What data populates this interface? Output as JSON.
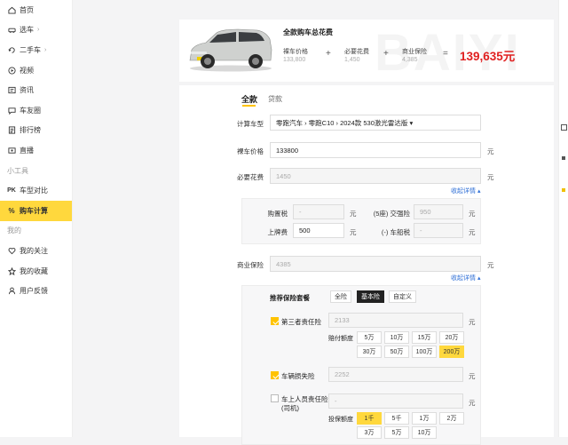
{
  "sidebar": {
    "items": [
      {
        "label": "首页",
        "icon": "home-icon"
      },
      {
        "label": "选车",
        "icon": "car-icon",
        "chev": "›"
      },
      {
        "label": "二手车",
        "icon": "used-car-icon",
        "chev": "›"
      },
      {
        "label": "视频",
        "icon": "video-icon"
      },
      {
        "label": "资讯",
        "icon": "news-icon"
      },
      {
        "label": "车友圈",
        "icon": "community-icon"
      },
      {
        "label": "排行榜",
        "icon": "ranking-icon"
      },
      {
        "label": "直播",
        "icon": "live-icon"
      }
    ],
    "section_tools": "小工具",
    "tools": [
      {
        "label": "车型对比",
        "icon": "compare-icon",
        "prefix": "PK"
      },
      {
        "label": "购车计算",
        "icon": "calculator-icon",
        "prefix": "%"
      }
    ],
    "section_mine": "我的",
    "mine": [
      {
        "label": "我的关注",
        "icon": "heart-icon"
      },
      {
        "label": "我的收藏",
        "icon": "star-icon"
      },
      {
        "label": "用户反馈",
        "icon": "feedback-icon"
      }
    ]
  },
  "summary": {
    "title": "全款购车总花费",
    "bg_word": "BAIYI",
    "price_label": "裸车价格",
    "price_value": "133,800",
    "required_label": "必要花费",
    "required_value": "1,450",
    "insurance_label": "商业保险",
    "insurance_value": "4,385",
    "plus": "+",
    "equals": "=",
    "total": "139,635元",
    "colors": {
      "accent": "#e02020",
      "brand": "#ffd83d"
    }
  },
  "tabs": {
    "full": "全款",
    "loan": "贷款"
  },
  "form": {
    "model_label": "计算车型",
    "model_value": "零跑汽车 › 零跑C10 › 2024款 530激光雷达版 ▾",
    "price_label": "裸车价格",
    "price_value": "133800",
    "unit": "元",
    "required_label": "必要花费",
    "required_value": "1450",
    "collapse_link": "收起详情 ▴",
    "purchase_tax_label": "购置税",
    "purchase_tax_value": "-",
    "compulsory_label": "(5座) 交强险",
    "compulsory_value": "950",
    "license_label": "上牌费",
    "license_value": "500",
    "vehicle_tax_label": "(-) 车船税",
    "vehicle_tax_value": "-",
    "insurance_label": "商业保险",
    "insurance_value": "4385",
    "plan_label": "推荐保险套餐",
    "plans": [
      "全险",
      "基本险",
      "自定义"
    ],
    "third_party_label": "第三者责任险",
    "third_party_value": "2133",
    "amount_label": "赔付额度",
    "amounts_row1": [
      "5万",
      "10万",
      "15万",
      "20万"
    ],
    "amounts_row2": [
      "30万",
      "50万",
      "100万",
      "200万"
    ],
    "damage_label": "车辆损失险",
    "damage_value": "2252",
    "passenger_label": "车上人员责任险",
    "passenger_label2": "(司机)",
    "passenger_value": "-",
    "coverage_label": "投保额度",
    "coverage_row1": [
      "1千",
      "5千",
      "1万",
      "2万"
    ],
    "coverage_row2": [
      "3万",
      "5万",
      "10万"
    ]
  }
}
